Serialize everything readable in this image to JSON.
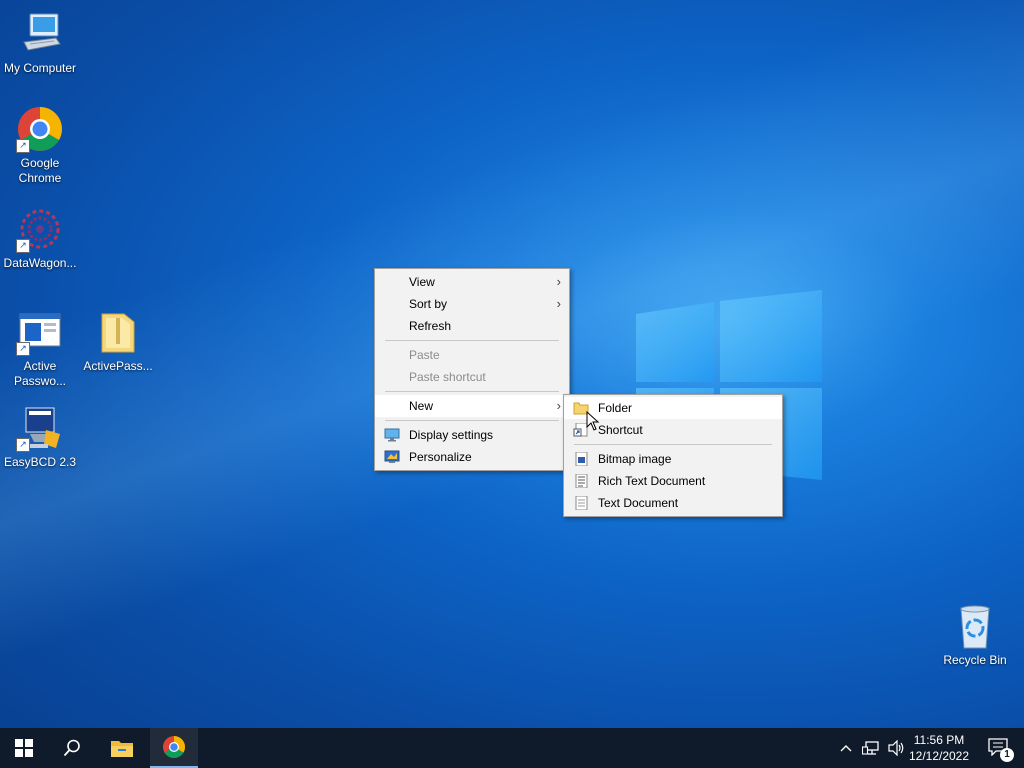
{
  "desktop_icons": [
    {
      "name": "my-computer",
      "label": "My Computer"
    },
    {
      "name": "google-chrome",
      "label": "Google\nChrome"
    },
    {
      "name": "datawagon",
      "label": "DataWagon..."
    },
    {
      "name": "active-password",
      "label": "Active\nPasswo..."
    },
    {
      "name": "activepass-folder",
      "label": "ActivePass..."
    },
    {
      "name": "easybcd",
      "label": "EasyBCD 2.3"
    },
    {
      "name": "recycle-bin",
      "label": "Recycle Bin"
    }
  ],
  "context_menu": {
    "items": [
      {
        "label": "View",
        "submenu": true
      },
      {
        "label": "Sort by",
        "submenu": true
      },
      {
        "label": "Refresh"
      },
      {
        "label": "Paste",
        "disabled": true
      },
      {
        "label": "Paste shortcut",
        "disabled": true
      },
      {
        "label": "New",
        "submenu": true,
        "highlighted": true
      },
      {
        "label": "Display settings",
        "icon": "display-icon"
      },
      {
        "label": "Personalize",
        "icon": "personalize-icon"
      }
    ]
  },
  "new_submenu": {
    "items": [
      {
        "label": "Folder",
        "icon": "folder-icon",
        "highlighted": true
      },
      {
        "label": "Shortcut",
        "icon": "shortcut-icon"
      },
      {
        "label": "Bitmap image",
        "icon": "bitmap-icon"
      },
      {
        "label": "Rich Text Document",
        "icon": "rtf-icon"
      },
      {
        "label": "Text Document",
        "icon": "text-icon"
      }
    ]
  },
  "taskbar": {
    "clock_time": "11:56 PM",
    "clock_date": "12/12/2022",
    "notification_count": "1",
    "pinned": [
      "start-button",
      "search-button",
      "file-explorer",
      "google-chrome"
    ]
  },
  "colors": {
    "accent": "#0d63c6",
    "taskbar": "#0f1a2a",
    "menu_bg": "#f2f2f2"
  }
}
